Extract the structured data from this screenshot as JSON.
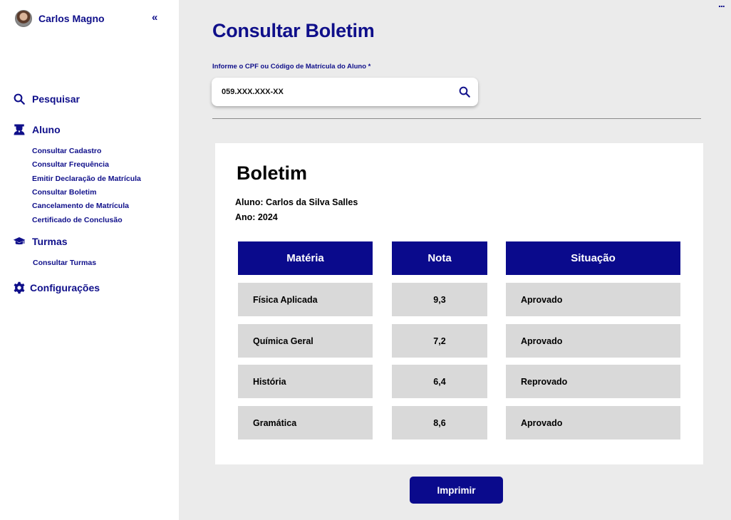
{
  "user": {
    "name": "Carlos Magno"
  },
  "sidebar": {
    "collapse_label": "«",
    "search_label": "Pesquisar",
    "aluno": {
      "label": "Aluno",
      "items": [
        "Consultar Cadastro",
        "Consultar Frequência",
        "Emitir Declaração de Matrícula",
        "Consultar Boletim",
        "Cancelamento de Matrícula",
        "Certificado de Conclusão"
      ]
    },
    "turmas": {
      "label": "Turmas",
      "items": [
        "Consultar Turmas"
      ]
    },
    "config_label": "Configurações"
  },
  "main": {
    "title": "Consultar Boletim",
    "field_label": "Informe o CPF ou Código de Matrícula do Aluno *",
    "search_value": "059.XXX.XXX-XX",
    "more_label": "..."
  },
  "boletim": {
    "title": "Boletim",
    "aluno": "Aluno: Carlos da Silva Salles",
    "ano": "Ano: 2024",
    "headers": [
      "Matéria",
      "Nota",
      "Situação"
    ],
    "rows": [
      [
        "Física Aplicada",
        "9,3",
        "Aprovado"
      ],
      [
        "Química Geral",
        "7,2",
        "Aprovado"
      ],
      [
        "História",
        "6,4",
        "Reprovado"
      ],
      [
        "Gramática",
        "8,6",
        "Aprovado"
      ]
    ]
  },
  "actions": {
    "print_label": "Imprimir"
  },
  "colors": {
    "primary": "#0a0a8c",
    "background": "#ebebeb",
    "cell": "#d9d9d9"
  },
  "icons": {
    "search": "search-icon",
    "aluno": "student-icon",
    "turmas": "graduation-cap-icon",
    "config": "gear-icon"
  }
}
